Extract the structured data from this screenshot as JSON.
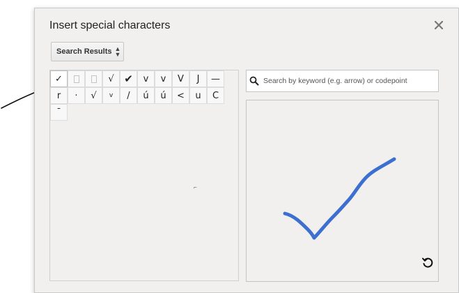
{
  "dialog": {
    "title": "Insert special characters",
    "close_icon": "close-icon",
    "category": {
      "selected": "Search Results",
      "icon": "updown-caret-icon"
    }
  },
  "character_grid": {
    "rows": [
      [
        "✓",
        "",
        "",
        "√",
        "✔",
        "v",
        "v",
        "V",
        "J",
        "—"
      ],
      [
        "r",
        "·",
        "√",
        "v",
        "/",
        "ú",
        "ú",
        "<",
        "u",
        "C"
      ],
      [
        "¯"
      ]
    ],
    "missing_glyph_cells": [
      [
        0,
        1
      ],
      [
        0,
        2
      ]
    ],
    "stray_mark": "⌐"
  },
  "search": {
    "placeholder": "Search by keyword (e.g. arrow) or codepoint",
    "value": "",
    "icon": "search-icon"
  },
  "drawing": {
    "stroke_color": "#3d6fd1",
    "drawn_glyph": "checkmark",
    "reset_icon": "reset-icon"
  },
  "annotation": {
    "arrow_color": "#111111"
  }
}
